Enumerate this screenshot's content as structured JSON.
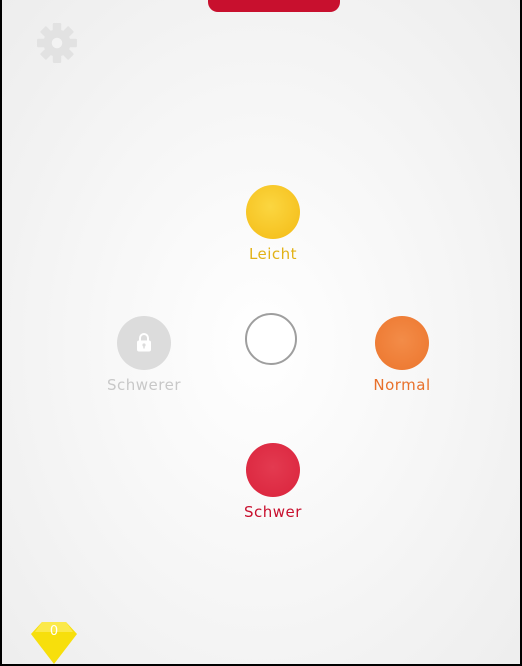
{
  "settings": {
    "icon": "gear-icon"
  },
  "difficulty": {
    "options": [
      {
        "label": "Leicht",
        "color": "#f6c322",
        "locked": false
      },
      {
        "label": "Normal",
        "color": "#ee7c35",
        "locked": false
      },
      {
        "label": "Schwer",
        "color": "#dd2a42",
        "locked": false
      },
      {
        "label": "Schwerer",
        "color": "#dcdcdc",
        "locked": true,
        "icon": "lock-icon"
      }
    ]
  },
  "gems": {
    "count": "0",
    "icon": "diamond-icon",
    "color": "#f7df0c"
  }
}
